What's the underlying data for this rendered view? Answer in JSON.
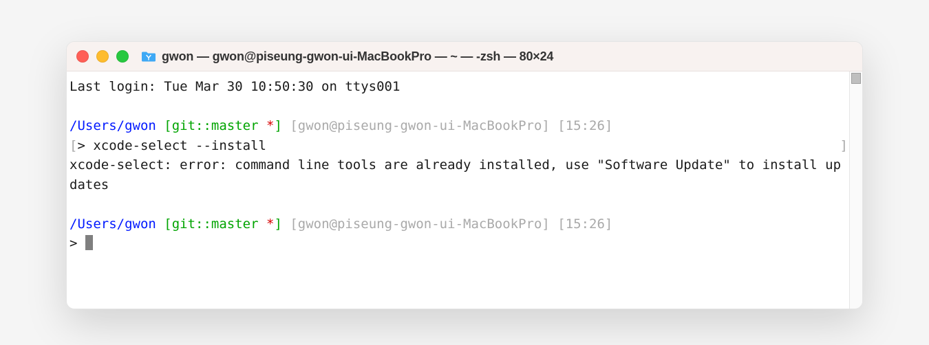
{
  "window": {
    "title": "gwon — gwon@piseung-gwon-ui-MacBookPro — ~ — -zsh — 80×24"
  },
  "terminal": {
    "last_login": "Last login: Tue Mar 30 10:50:30 on ttys001",
    "prompt1": {
      "path": "/Users/gwon",
      "git_open": " [git::master",
      "asterisk": " *",
      "git_close": "]",
      "meta": " [gwon@piseung-gwon-ui-MacBookPro] [15:26]",
      "line_open": "[",
      "arrow": "> ",
      "command": "xcode-select --install",
      "line_close": "]"
    },
    "error": "xcode-select: error: command line tools are already installed, use \"Software Update\" to install updates",
    "prompt2": {
      "path": "/Users/gwon",
      "git_open": " [git::master",
      "asterisk": " *",
      "git_close": "]",
      "meta": " [gwon@piseung-gwon-ui-MacBookPro] [15:26]",
      "arrow": "> "
    }
  }
}
